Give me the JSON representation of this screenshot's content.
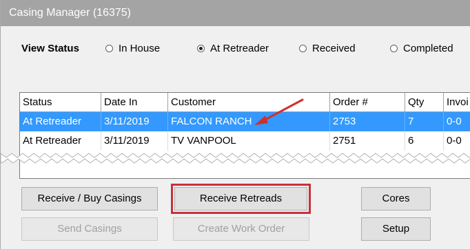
{
  "window": {
    "title": "Casing Manager (16375)"
  },
  "view_status": {
    "label": "View Status",
    "options": [
      {
        "label": "In House",
        "selected": false
      },
      {
        "label": "At Retreader",
        "selected": true
      },
      {
        "label": "Received",
        "selected": false
      },
      {
        "label": "Completed",
        "selected": false
      }
    ]
  },
  "grid": {
    "columns": [
      "Status",
      "Date In",
      "Customer",
      "Order #",
      "Qty",
      "Invoi"
    ],
    "rows": [
      {
        "status": "At Retreader",
        "date_in": "3/11/2019",
        "customer": "FALCON RANCH",
        "order": "2753",
        "qty": "7",
        "invoice": "0-0",
        "selected": true
      },
      {
        "status": "At Retreader",
        "date_in": "3/11/2019",
        "customer": "TV VANPOOL",
        "order": "2751",
        "qty": "6",
        "invoice": "0-0",
        "selected": false
      }
    ]
  },
  "buttons": {
    "receive_buy_casings": "Receive / Buy Casings",
    "receive_retreads": "Receive Retreads",
    "cores": "Cores",
    "send_casings": "Send Casings",
    "create_work_order": "Create Work Order",
    "setup": "Setup"
  },
  "colors": {
    "selection": "#3399ff",
    "highlight_box": "#c8303a",
    "arrow": "#d03030"
  }
}
